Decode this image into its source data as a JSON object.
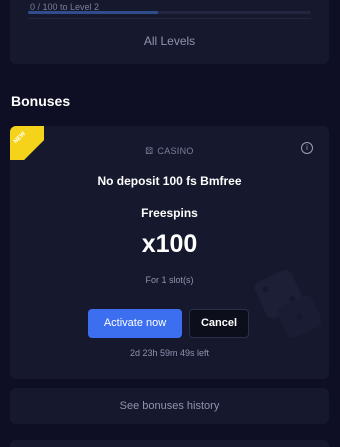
{
  "levels": {
    "progress_label": "0 / 100 to Level 2",
    "progress_fraction": 0.46,
    "all_levels_label": "All Levels"
  },
  "bonuses": {
    "section_title": "Bonuses",
    "card": {
      "ribbon_text": "NEW",
      "category_icon": "dice-icon",
      "category": "CASINO",
      "title": "No deposit 100 fs Bmfree",
      "reward_type": "Freespins",
      "reward_amount": "x100",
      "slot_note": "For 1 slot(s)",
      "activate_label": "Activate now",
      "cancel_label": "Cancel",
      "time_left": "2d 23h 59m 49s left"
    },
    "history_label": "See bonuses history"
  },
  "colors": {
    "background": "#0e0f24",
    "card": "#16182e",
    "accent": "#3c6ff0",
    "ribbon": "#f5d31a"
  }
}
